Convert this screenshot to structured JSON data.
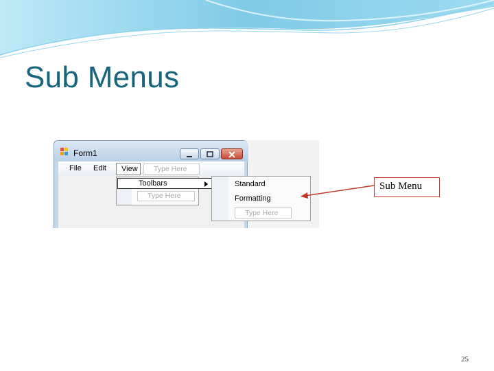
{
  "slide": {
    "title": "Sub Menus",
    "page_number": "25",
    "callout_label": "Sub Menu"
  },
  "window": {
    "title": "Form1",
    "menubar": {
      "items": [
        "File",
        "Edit",
        "View"
      ],
      "type_here": "Type Here"
    },
    "view_dropdown": {
      "items": [
        "Toolbars"
      ],
      "type_here": "Type Here"
    },
    "toolbars_submenu": {
      "items": [
        "Standard",
        "Formatting"
      ],
      "type_here": "Type Here"
    }
  },
  "colors": {
    "title": "#17667e",
    "accent_wave": "#8fd3ec",
    "callout_border": "#c0392b",
    "arrow": "#c0392b"
  }
}
